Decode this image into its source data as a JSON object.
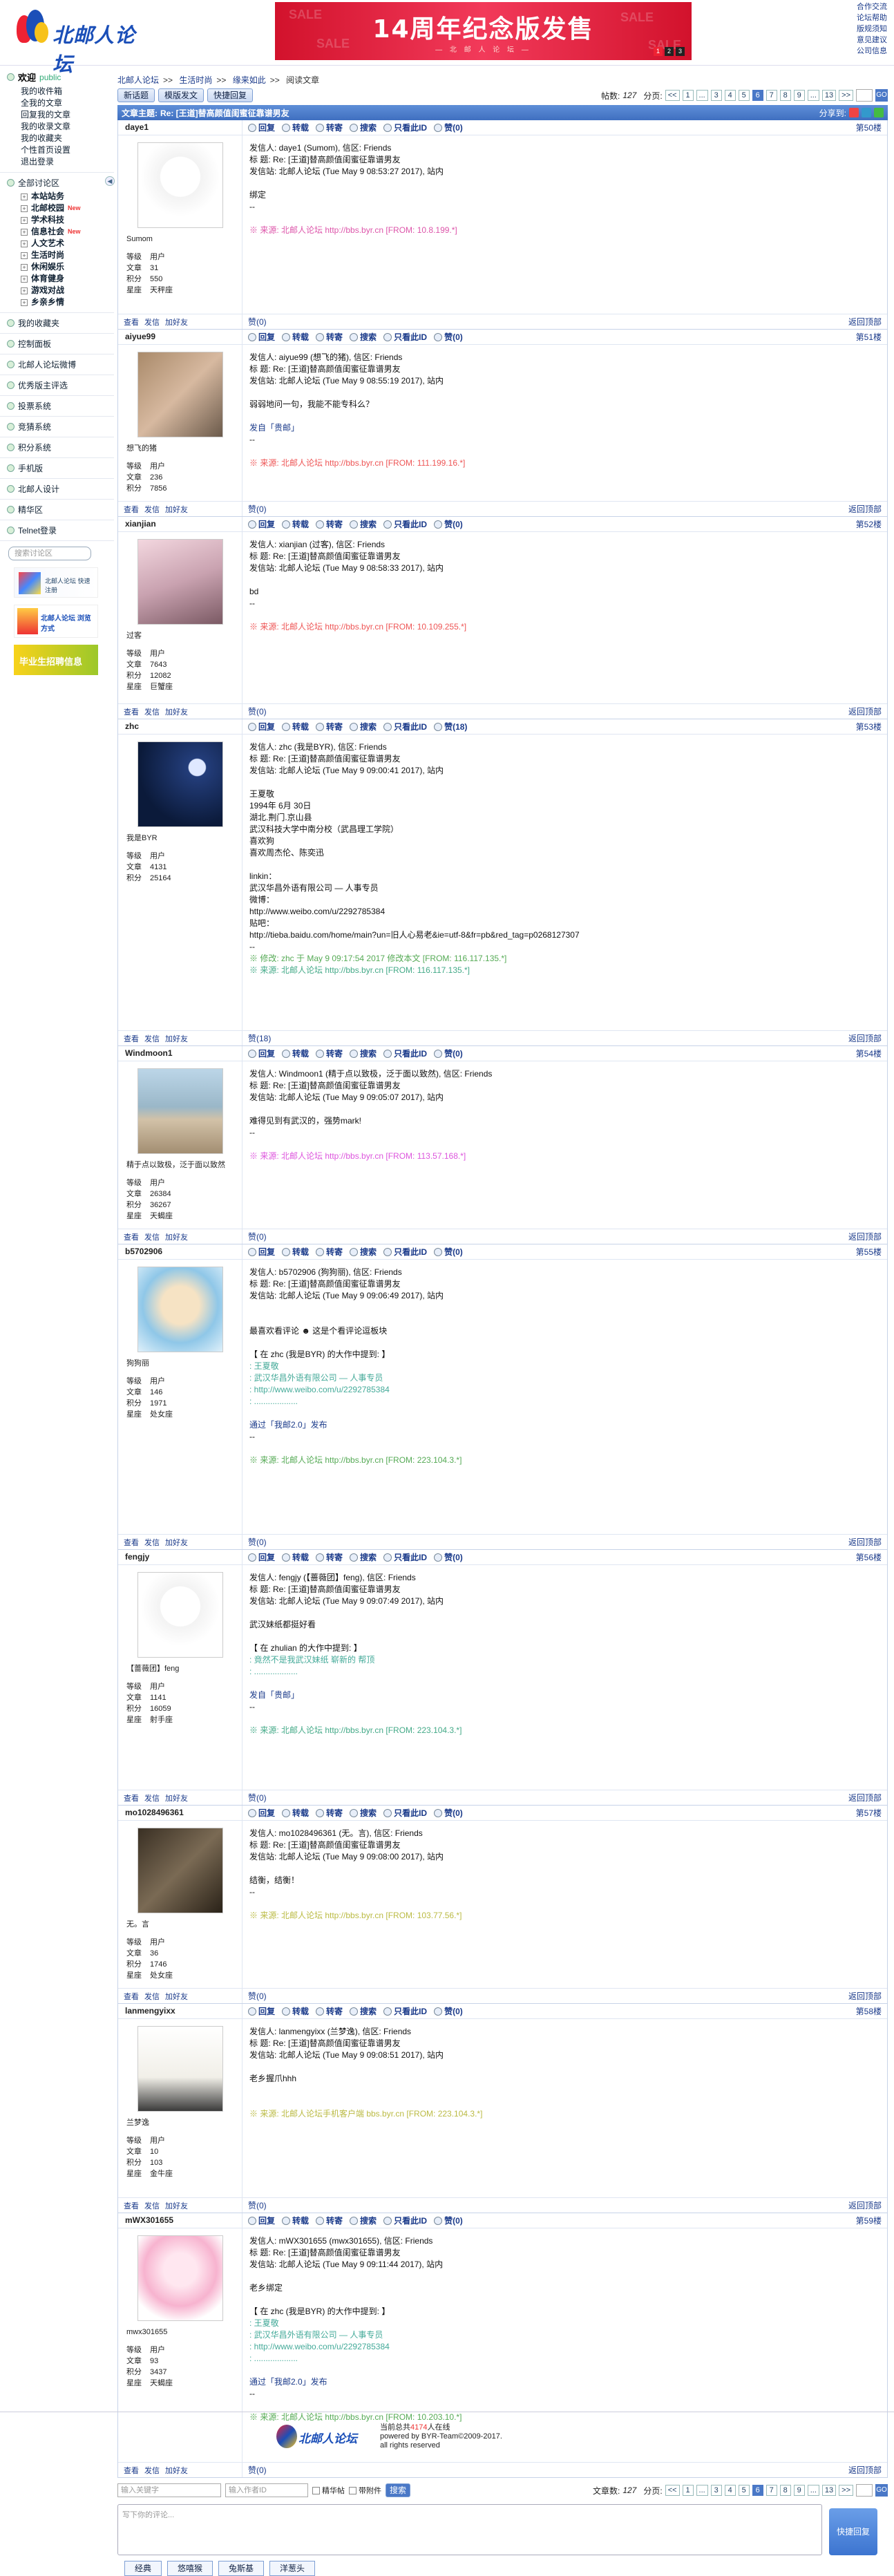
{
  "header": {
    "logo_text": "北邮人论坛",
    "banner_title": "14周年纪念版发售",
    "banner_sub": "— 北 邮 人 论 坛 —",
    "banner_dots": [
      "1",
      "2",
      "3"
    ],
    "top_links": [
      "合作交流",
      "论坛帮助",
      "版规须知",
      "意见建议",
      "公司信息"
    ]
  },
  "sidebar": {
    "welcome": "欢迎",
    "user": "public",
    "user_links": [
      "我的收件箱",
      "全我的文章",
      "回复我的文章",
      "我的收录文章",
      "我的收藏夹",
      "个性首页设置",
      "退出登录"
    ],
    "forum_title": "全部讨论区",
    "boards": [
      "本站站务",
      "北邮校园",
      "学术科技",
      "信息社会",
      "人文艺术",
      "生活时尚",
      "休闲娱乐",
      "体育健身",
      "游戏对战",
      "乡亲乡情"
    ],
    "board_tag": "New",
    "menu": [
      "我的收藏夹",
      "控制面板",
      "北邮人论坛微博",
      "优秀版主评选",
      "投票系统",
      "竞猜系统",
      "积分系统",
      "手机版",
      "北邮人设计",
      "精华区",
      "Telnet登录"
    ],
    "search_placeholder": "搜索讨论区",
    "ad1": "北邮人论坛 快速注册",
    "ad2": "北邮人论坛 浏览方式",
    "ad3": "毕业生招聘信息"
  },
  "crumb": [
    "北邮人论坛",
    "生活时尚",
    "缘来如此",
    "阅读文章"
  ],
  "toolbar": {
    "new_post": "新话题",
    "template_post": "模版发文",
    "quick_reply": "快捷回复",
    "article_count_label": "帖数:",
    "article_count": "127",
    "pager_label": "分页:",
    "pages": [
      "<<",
      "1",
      "...",
      "3",
      "4",
      "5",
      "6",
      "7",
      "8",
      "9",
      "...",
      "13",
      ">>"
    ],
    "current_page": "6",
    "go": "GO"
  },
  "topic": {
    "title_label": "文章主题:",
    "title": "Re: [王道]替高颜值闺蜜征靠谱男友",
    "share_label": "分享到:"
  },
  "labels": {
    "reply": "回复",
    "forward": "转载",
    "repost": "转寄",
    "search": "搜索",
    "only_author": "只看此ID",
    "delete": "赞(0)",
    "view": "查看",
    "mail": "发信",
    "add_friend": "加好友",
    "back_top": "返回顶部",
    "level": "等级",
    "articles": "文章",
    "points": "积分",
    "star": "星座",
    "user_level": "用户"
  },
  "posts": [
    {
      "id": "daye1",
      "floor": "第50楼",
      "nick": "Sumom",
      "arts": "31",
      "pts": "550",
      "star": "天秤座",
      "likes": "赞(0)",
      "lines": [
        "发信人: daye1 (Sumom), 信区: Friends",
        "标 题: Re: [王道]替高颜值闺蜜征靠谱男友",
        "发信站: 北邮人论坛 (Tue May  9 08:53:27 2017), 站内",
        "",
        "绑定",
        "--",
        ""
      ],
      "src": "※ 来源: 北邮人论坛 http://bbs.byr.cn [FROM: 10.8.199.*]",
      "src_color": "#d5a"
    },
    {
      "id": "aiyue99",
      "floor": "第51楼",
      "nick": "想飞的猪",
      "arts": "236",
      "pts": "7856",
      "star": "",
      "likes": "赞(0)",
      "lines": [
        "发信人: aiyue99 (想飞的猪), 信区: Friends",
        "标 题: Re: [王道]替高颜值闺蜜征靠谱男友",
        "发信站: 北邮人论坛 (Tue May  9 08:55:19 2017), 站内",
        "",
        "弱弱地问一句，我能不能专科么？",
        "",
        "发自「贵邮」",
        "--",
        ""
      ],
      "src": "※ 来源: 北邮人论坛 http://bbs.byr.cn [FROM: 111.199.16.*]",
      "src_color": "#e55"
    },
    {
      "id": "xianjian",
      "floor": "第52楼",
      "nick": "过客",
      "arts": "7643",
      "pts": "12082",
      "star": "巨蟹座",
      "likes": "赞(0)",
      "lines": [
        "发信人: xianjian (过客), 信区: Friends",
        "标 题: Re: [王道]替高颜值闺蜜征靠谱男友",
        "发信站: 北邮人论坛 (Tue May  9 08:58:33 2017), 站内",
        "",
        "bd",
        "--",
        ""
      ],
      "src": "※ 来源: 北邮人论坛 http://bbs.byr.cn [FROM: 10.109.255.*]",
      "src_color": "#e55"
    },
    {
      "id": "zhc",
      "floor": "第53楼",
      "nick": "我是BYR",
      "arts": "4131",
      "pts": "25164",
      "star": "",
      "likes": "赞(18)",
      "lines": [
        "发信人: zhc (我是BYR), 信区: Friends",
        "标 题: Re: [王道]替高颜值闺蜜征靠谱男友",
        "发信站: 北邮人论坛 (Tue May  9 09:00:41 2017), 站内",
        "",
        "王夏敬",
        "1994年 6月 30日",
        "湖北.荆门.京山县",
        "武汉科技大学中南分校（武昌理工学院）",
        "喜欢狗",
        "喜欢周杰伦、陈奕迅",
        "",
        "linkin：",
        "武汉华昌外语有限公司 — 人事专员",
        "微博：",
        "http://www.weibo.com/u/2292785384",
        "贴吧：",
        "http://tieba.baidu.com/home/main?un=旧人心易老&ie=utf-8&fr=pb&red_tag=p0268127307",
        "--"
      ],
      "src": "※ 修改: zhc 于 May  9 09:17:54 2017 修改本文 [FROM: 116.117.135.*]",
      "src2": "※ 来源: 北邮人论坛 http://bbs.byr.cn [FROM: 116.117.135.*]",
      "src_color": "#5a5"
    },
    {
      "id": "Windmoon1",
      "floor": "第54楼",
      "nick": "精于点以致极，泛于面以致然",
      "arts": "26384",
      "pts": "36267",
      "star": "天蝎座",
      "likes": "赞(0)",
      "lines": [
        "发信人: Windmoon1 (精于点以致极，泛于面以致然), 信区: Friends",
        "标 题: Re: [王道]替高颜值闺蜜征靠谱男友",
        "发信站: 北邮人论坛 (Tue May  9 09:05:07 2017), 站内",
        "",
        "难得见到有武汉的，强势mark!",
        "--",
        ""
      ],
      "src": "※ 来源: 北邮人论坛 http://bbs.byr.cn [FROM: 113.57.168.*]",
      "src_color": "#d5d"
    },
    {
      "id": "b5702906",
      "floor": "第55楼",
      "nick": "狗狗丽",
      "arts": "146",
      "pts": "1971",
      "star": "处女座",
      "likes": "赞(0)",
      "lines": [
        "发信人: b5702906 (狗狗丽), 信区: Friends",
        "标 题: Re: [王道]替高颜值闺蜜征靠谱男友",
        "发信站: 北邮人论坛 (Tue May  9 09:06:49 2017), 站内",
        "",
        "",
        "最喜欢看评论 ☻ 这是个看评论逗板块",
        "",
        "【 在 zhc (我是BYR) 的大作中提到: 】",
        ": 王夏敬",
        ": 武汉华昌外语有限公司 — 人事专员",
        ": http://www.weibo.com/u/2292785384",
        ": ...................",
        "",
        "通过「我邮2.0」发布",
        "--",
        ""
      ],
      "src": "※ 来源: 北邮人论坛 http://bbs.byr.cn [FROM: 223.104.3.*]",
      "src_color": "#5a5"
    },
    {
      "id": "fengjy",
      "floor": "第56楼",
      "nick": "【蔷薇团】feng",
      "arts": "1141",
      "pts": "16059",
      "star": "射手座",
      "likes": "赞(0)",
      "lines": [
        "发信人: fengjy (【蔷薇团】feng), 信区: Friends",
        "标 题: Re: [王道]替高颜值闺蜜征靠谱男友",
        "发信站: 北邮人论坛 (Tue May  9 09:07:49 2017), 站内",
        "",
        "武汉妹纸都挺好看",
        "",
        "【 在 zhulian 的大作中提到: 】",
        ": 竟然不是我武汉妹纸  崭新的 帮顶",
        ": ...................",
        "",
        "发自「贵邮」",
        "--",
        ""
      ],
      "src": "※ 来源: 北邮人论坛 http://bbs.byr.cn [FROM: 223.104.3.*]",
      "src_color": "#4a8"
    },
    {
      "id": "mo1028496361",
      "floor": "第57楼",
      "nick": "无。言",
      "arts": "36",
      "pts": "1746",
      "star": "处女座",
      "likes": "赞(0)",
      "lines": [
        "发信人: mo1028496361 (无。言), 信区: Friends",
        "标 题: Re: [王道]替高颜值闺蜜征靠谱男友",
        "发信站: 北邮人论坛 (Tue May  9 09:08:00 2017), 站内",
        "",
        "结衡，结衡！",
        "--",
        ""
      ],
      "src": "※ 来源: 北邮人论坛 http://bbs.byr.cn [FROM: 103.77.56.*]",
      "src_color": "#bb4"
    },
    {
      "id": "lanmengyixx",
      "floor": "第58楼",
      "nick": "兰梦逸",
      "arts": "10",
      "pts": "103",
      "star": "金牛座",
      "likes": "赞(0)",
      "lines": [
        "发信人: lanmengyixx (兰梦逸), 信区: Friends",
        "标 题: Re: [王道]替高颜值闺蜜征靠谱男友",
        "发信站: 北邮人论坛 (Tue May  9 09:08:51 2017), 站内",
        "",
        "老乡握爪hhh",
        "",
        ""
      ],
      "src": "※ 来源: 北邮人论坛手机客户端 bbs.byr.cn [FROM: 223.104.3.*]",
      "src_color": "#bb4"
    },
    {
      "id": "mWX301655",
      "floor": "第59楼",
      "nick": "mwx301655",
      "arts": "93",
      "pts": "3437",
      "star": "天蝎座",
      "likes": "赞(0)",
      "lines": [
        "发信人: mWX301655 (mwx301655), 信区: Friends",
        "标 题: Re: [王道]替高颜值闺蜜征靠谱男友",
        "发信站: 北邮人论坛 (Tue May  9 09:11:44 2017), 站内",
        "",
        "老乡绑定",
        "",
        "【 在 zhc (我是BYR) 的大作中提到: 】",
        ": 王夏敬",
        ": 武汉华昌外语有限公司 — 人事专员",
        ": http://www.weibo.com/u/2292785384",
        ": ...................",
        "",
        "通过「我邮2.0」发布",
        "--",
        ""
      ],
      "src": "※ 来源: 北邮人论坛 http://bbs.byr.cn [FROM: 10.203.10.*]",
      "src_color": "#5a5"
    }
  ],
  "bottom": {
    "kw_placeholder": "输入关键字",
    "author_placeholder": "输入作者ID",
    "only_digest": "精华帖",
    "only_attach": "带附件",
    "search_btn": "搜索",
    "article_count_label": "文章数:",
    "reply_placeholder": "写下你的评论...",
    "quick_reply_btn": "快捷回复",
    "emoji_tabs": [
      "经典",
      "悠嘻猴",
      "兔斯基",
      "洋葱头"
    ]
  },
  "footer": {
    "online_prefix": "当前总共",
    "online_count": "4174",
    "online_suffix": "人在线",
    "powered": "powered by BYR-Team©2009-2017.",
    "rights": "all rights reserved"
  }
}
